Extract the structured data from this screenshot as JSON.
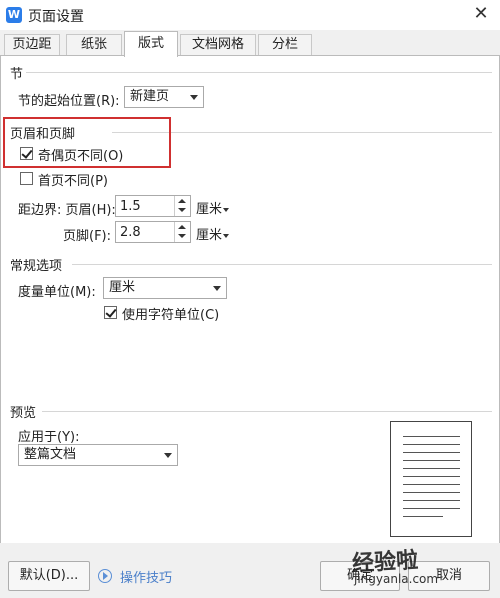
{
  "window": {
    "title": "页面设置",
    "close_label": "✕"
  },
  "tabs": [
    {
      "label": "页边距",
      "active": false
    },
    {
      "label": "纸张",
      "active": false
    },
    {
      "label": "版式",
      "active": true
    },
    {
      "label": "文档网格",
      "active": false
    },
    {
      "label": "分栏",
      "active": false
    }
  ],
  "section": {
    "heading": "节",
    "start_label": "节的起始位置(R):",
    "start_value": "新建页"
  },
  "header_footer": {
    "heading": "页眉和页脚",
    "odd_even_label": "奇偶页不同(O)",
    "odd_even_checked": true,
    "first_page_label": "首页不同(P)",
    "first_page_checked": false,
    "distance_label": "距边界: 页眉(H):",
    "header_value": "1.5",
    "footer_label": "页脚(F):",
    "footer_value": "2.8",
    "unit": "厘米"
  },
  "general": {
    "heading": "常规选项",
    "measure_label": "度量单位(M):",
    "measure_value": "厘米",
    "char_unit_label": "使用字符单位(C)",
    "char_unit_checked": true
  },
  "preview": {
    "heading": "预览",
    "apply_label": "应用于(Y):",
    "apply_value": "整篇文档"
  },
  "footer": {
    "default_button": "默认(D)...",
    "tips_link": "操作技巧",
    "ok_button": "确定",
    "cancel_button": "取消"
  },
  "watermark": {
    "text": "经验啦",
    "url": "jingyanla.com"
  }
}
